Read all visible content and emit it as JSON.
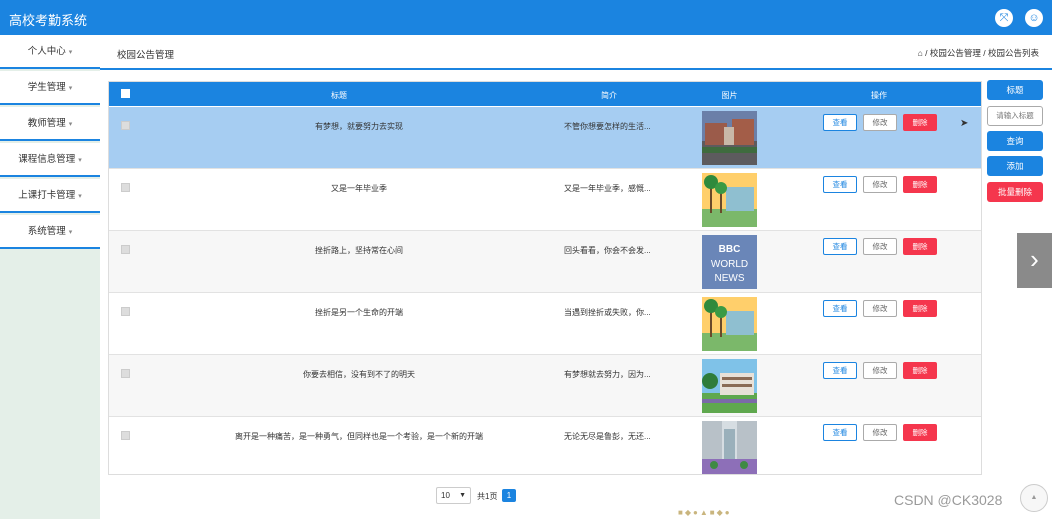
{
  "app": {
    "title": "高校考勤系统"
  },
  "header_icons": [
    "fullscreen-icon",
    "user-icon"
  ],
  "sidebar": {
    "items": [
      {
        "label": "个人中心"
      },
      {
        "label": "学生管理"
      },
      {
        "label": "教师管理"
      },
      {
        "label": "课程信息管理"
      },
      {
        "label": "上课打卡管理"
      },
      {
        "label": "系统管理"
      }
    ]
  },
  "breadcrumb": {
    "page_title": "校园公告管理",
    "separator": "/",
    "items": [
      "校园公告管理",
      "校园公告列表"
    ]
  },
  "table": {
    "columns": [
      "标题",
      "简介",
      "图片",
      "操作"
    ],
    "rows": [
      {
        "title": "有梦想，就要努力去实现",
        "intro": "不管你想要怎样的生活...",
        "highlighted": true,
        "thumb": "campus-building-dusk"
      },
      {
        "title": "又是一年毕业季",
        "intro": "又是一年毕业季，感慨...",
        "highlighted": false,
        "thumb": "campus-palms"
      },
      {
        "title": "挫折路上，坚持常在心间",
        "intro": "回头看看，你会不会发...",
        "highlighted": false,
        "thumb": "bbc-world-news"
      },
      {
        "title": "挫折是另一个生命的开端",
        "intro": "当遇到挫折或失败，你...",
        "highlighted": false,
        "thumb": "campus-palms"
      },
      {
        "title": "你要去相信，没有到不了的明天",
        "intro": "有梦想就去努力，因为...",
        "highlighted": false,
        "thumb": "campus-modern"
      },
      {
        "title": "离开是一种痛苦，是一种勇气，但同样也是一个考验，是一个新的开端",
        "intro": "无论无尽是鲁彭，无还...",
        "highlighted": false,
        "thumb": "campus-courtyard"
      }
    ],
    "bbc_text": [
      "BBC",
      "WORLD",
      "NEWS"
    ],
    "buttons": {
      "view": "查看",
      "edit": "修改",
      "delete": "删除"
    }
  },
  "pagination": {
    "page_size": "10",
    "total_text": "共1页",
    "current_page": "1"
  },
  "actions": {
    "title_label": "标题",
    "search_placeholder": "请输入标题",
    "search": "查询",
    "add": "添加",
    "batch_delete": "批量删除"
  },
  "watermark": "CSDN @CK3028",
  "colors": {
    "primary": "#1b84e0",
    "danger": "#f5364d",
    "highlight_row": "#a6cdf2",
    "sidebar_bg": "#e4efe8"
  }
}
